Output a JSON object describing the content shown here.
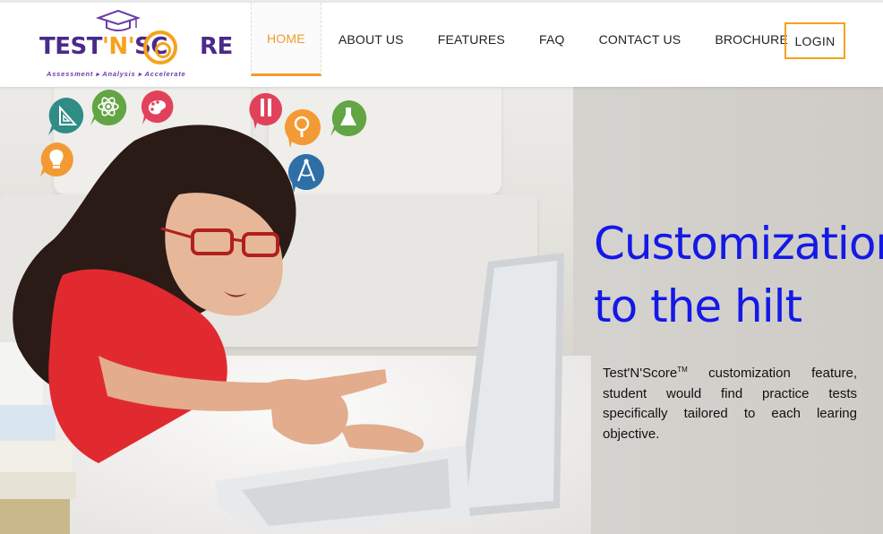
{
  "brand": {
    "logo_text_a": "TEST",
    "logo_text_b": "'N'",
    "logo_text_c": "SC",
    "logo_text_d": "RE",
    "tagline": "Assessment ▸ Analysis ▸ Accelerate",
    "primary_color": "#4b2a8a",
    "accent_color": "#f7a21b"
  },
  "nav": {
    "items": [
      {
        "label": "HOME",
        "active": true
      },
      {
        "label": "ABOUT US"
      },
      {
        "label": "FEATURES"
      },
      {
        "label": "FAQ"
      },
      {
        "label": "CONTACT US"
      },
      {
        "label": "BROCHURE"
      }
    ],
    "login_label": "LOGIN"
  },
  "hero": {
    "title_line1": "Customization",
    "title_line2": "to the hilt",
    "title_color": "#1419e6",
    "desc_brand": "Test'N'Score",
    "desc_tm": "TM",
    "desc_body": " customization feature, student would find practice tests specifically tailored to each learing objective.",
    "subject_icons": [
      "ruler-triangle-icon",
      "atom-icon",
      "palette-icon",
      "lightbulb-icon",
      "pencil-icon",
      "magnifier-icon",
      "flask-icon",
      "compass-icon"
    ]
  }
}
